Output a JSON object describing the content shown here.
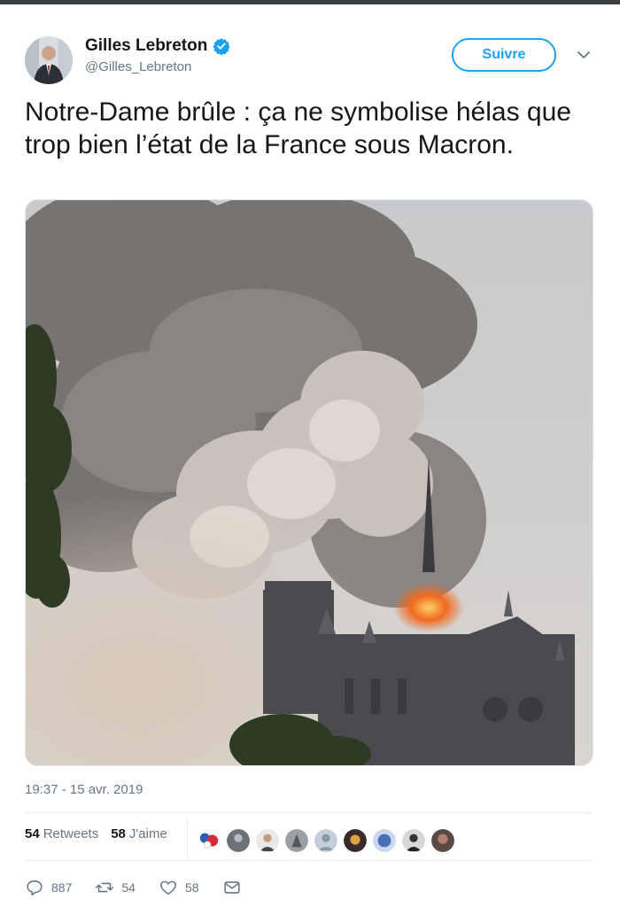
{
  "tweet": {
    "author_name": "Gilles Lebreton",
    "author_handle": "@Gilles_Lebreton",
    "follow_label": "Suivre",
    "text": "Notre-Dame brûle : ça ne symbolise hélas que trop bien l’état de la France sous Macron.",
    "timestamp": "19:37 - 15 avr. 2019",
    "retweets_count": "54",
    "retweets_label": "Retweets",
    "likes_count": "58",
    "likes_label": "J'aime",
    "reply_count": "887",
    "retweet_action_count": "54",
    "like_action_count": "58"
  },
  "icons": {
    "verified": "verified-badge-icon",
    "caret": "chevron-down-icon",
    "reply": "reply-icon",
    "retweet": "retweet-icon",
    "like": "heart-icon",
    "dm": "mail-icon"
  },
  "colors": {
    "accent": "#1da1f2",
    "muted": "#657786"
  }
}
